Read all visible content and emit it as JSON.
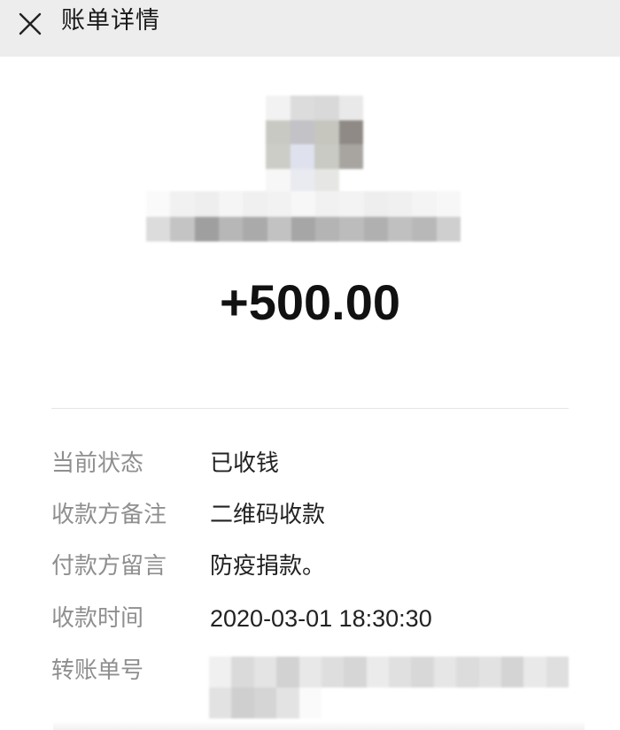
{
  "header": {
    "title": "账单详情",
    "close_icon": "close-icon"
  },
  "payer": {
    "avatar_colors": [
      "#f2f2f2",
      "#dcdcdc",
      "#d9d9d9",
      "#e9e9e9",
      "#c9c9c4",
      "#c2c2c7",
      "#c6c6bf",
      "#8f8a86",
      "#cdcdc8",
      "#dfe2ee",
      "#c8cac3",
      "#a8a5a0",
      "#f7f7f7",
      "#e9ebf1",
      "#e6e7e4",
      "#ffffff"
    ],
    "name_colors": [
      "#fafafa",
      "#f1f1f1",
      "#eeeeee",
      "#f5f5f5",
      "#f0f0f0",
      "#f2f2f2",
      "#f7f7f7",
      "#f1f1f1",
      "#f3f3f3",
      "#eeeeee",
      "#f0f0f0",
      "#f4f4f4",
      "#f7f7f7",
      "#dcdcdc",
      "#c4c4c4",
      "#9f9f9f",
      "#b7b7b7",
      "#aaaaaa",
      "#c2c2c2",
      "#a6a6a6",
      "#b4b4b4",
      "#bcbcbc",
      "#b0b0b0",
      "#c0c0c0",
      "#b8b8b8",
      "#cfcfcf"
    ]
  },
  "amount": "+500.00",
  "details": {
    "status_label": "当前状态",
    "status_value": "已收钱",
    "payee_note_label": "收款方备注",
    "payee_note_value": "二维码收款",
    "payer_message_label": "付款方留言",
    "payer_message_value": "防疫捐款。",
    "time_label": "收款时间",
    "time_value": "2020-03-01 18:30:30",
    "transfer_no_label": "转账单号"
  },
  "transfer_no_colors": [
    "#f0f0f0",
    "#dadada",
    "#e4e4e4",
    "#d2d2d2",
    "#e8e8e8",
    "#dedede",
    "#d6d6d6",
    "#ebebeb",
    "#e0e0e0",
    "#d8d8d8",
    "#e6e6e6",
    "#dcdcdc",
    "#e2e2e2",
    "#d4d4d4",
    "#e9e9e9",
    "#dfdfdf",
    "#e2e2e2",
    "#cfcfcf",
    "#d5d5d5",
    "#e3e3e3",
    "#fafafa",
    "#ffffff",
    "#ffffff",
    "#ffffff",
    "#ffffff",
    "#ffffff",
    "#ffffff",
    "#ffffff",
    "#ffffff",
    "#ffffff",
    "#ffffff",
    "#ffffff"
  ]
}
